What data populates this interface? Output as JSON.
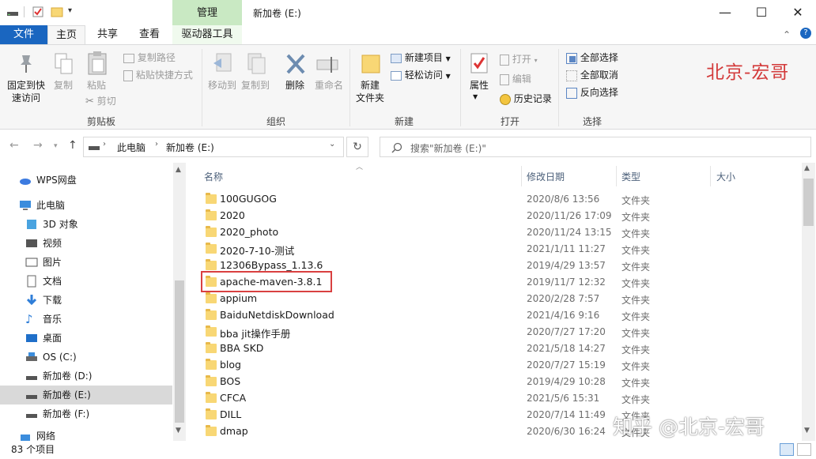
{
  "window": {
    "manage_tab": "管理",
    "title": "新加卷 (E:)",
    "min": "—",
    "max": "☐",
    "close": "✕"
  },
  "tabs": {
    "file": "文件",
    "home": "主页",
    "share": "共享",
    "view": "查看",
    "drive_tools": "驱动器工具"
  },
  "ribbon": {
    "clipboard": {
      "pin": "固定到快速访问",
      "pin_line1": "固定到快",
      "pin_line2": "速访问",
      "copy": "复制",
      "paste": "粘贴",
      "copy_path": "复制路径",
      "paste_shortcut": "粘贴快捷方式",
      "cut": "剪切",
      "group": "剪贴板"
    },
    "organize": {
      "move_to": "移动到",
      "copy_to": "复制到",
      "delete": "删除",
      "rename": "重命名",
      "group": "组织"
    },
    "new": {
      "new_folder_line1": "新建",
      "new_folder_line2": "文件夹",
      "new_item": "新建项目",
      "easy_access": "轻松访问",
      "group": "新建"
    },
    "open": {
      "properties": "属性",
      "open": "打开",
      "edit": "编辑",
      "history": "历史记录",
      "group": "打开"
    },
    "select": {
      "select_all": "全部选择",
      "select_none": "全部取消",
      "invert": "反向选择",
      "group": "选择"
    }
  },
  "watermark_top": "北京-宏哥",
  "address": {
    "path": [
      "此电脑",
      "新加卷 (E:)"
    ],
    "search_placeholder": "搜索\"新加卷 (E:)\""
  },
  "nav": [
    {
      "label": "WPS网盘"
    },
    {
      "label": "此电脑"
    },
    {
      "label": "3D 对象"
    },
    {
      "label": "视频"
    },
    {
      "label": "图片"
    },
    {
      "label": "文档"
    },
    {
      "label": "下载"
    },
    {
      "label": "音乐"
    },
    {
      "label": "桌面"
    },
    {
      "label": "OS (C:)"
    },
    {
      "label": "新加卷 (D:)"
    },
    {
      "label": "新加卷 (E:)"
    },
    {
      "label": "新加卷 (F:)"
    },
    {
      "label": "网络"
    }
  ],
  "columns": {
    "name": "名称",
    "date": "修改日期",
    "type": "类型",
    "size": "大小"
  },
  "files": [
    {
      "name": "100GUGOG",
      "date": "2020/8/6 13:56",
      "type": "文件夹"
    },
    {
      "name": "2020",
      "date": "2020/11/26 17:09",
      "type": "文件夹"
    },
    {
      "name": "2020_photo",
      "date": "2020/11/24 13:15",
      "type": "文件夹"
    },
    {
      "name": "2020-7-10-测试",
      "date": "2021/1/11 11:27",
      "type": "文件夹"
    },
    {
      "name": "12306Bypass_1.13.6",
      "date": "2019/4/29 13:57",
      "type": "文件夹"
    },
    {
      "name": "apache-maven-3.8.1",
      "date": "2019/11/7 12:32",
      "type": "文件夹"
    },
    {
      "name": "appium",
      "date": "2020/2/28 7:57",
      "type": "文件夹"
    },
    {
      "name": "BaiduNetdiskDownload",
      "date": "2021/4/16 9:16",
      "type": "文件夹"
    },
    {
      "name": "bba jit操作手册",
      "date": "2020/7/27 17:20",
      "type": "文件夹"
    },
    {
      "name": "BBA SKD",
      "date": "2021/5/18 14:27",
      "type": "文件夹"
    },
    {
      "name": "blog",
      "date": "2020/7/27 15:19",
      "type": "文件夹"
    },
    {
      "name": "BOS",
      "date": "2019/4/29 10:28",
      "type": "文件夹"
    },
    {
      "name": "CFCA",
      "date": "2021/5/6 15:31",
      "type": "文件夹"
    },
    {
      "name": "DILL",
      "date": "2020/7/14 11:49",
      "type": "文件夹"
    },
    {
      "name": "dmap",
      "date": "2020/6/30 16:24",
      "type": "文件夹"
    }
  ],
  "status": "83 个项目",
  "watermark_bottom": "知乎 @北京-宏哥",
  "colors": {
    "file_tab": "#1a66c0",
    "manage_tab": "#c9e9c3",
    "folder": "#f8d775",
    "highlight": "#d94040"
  }
}
